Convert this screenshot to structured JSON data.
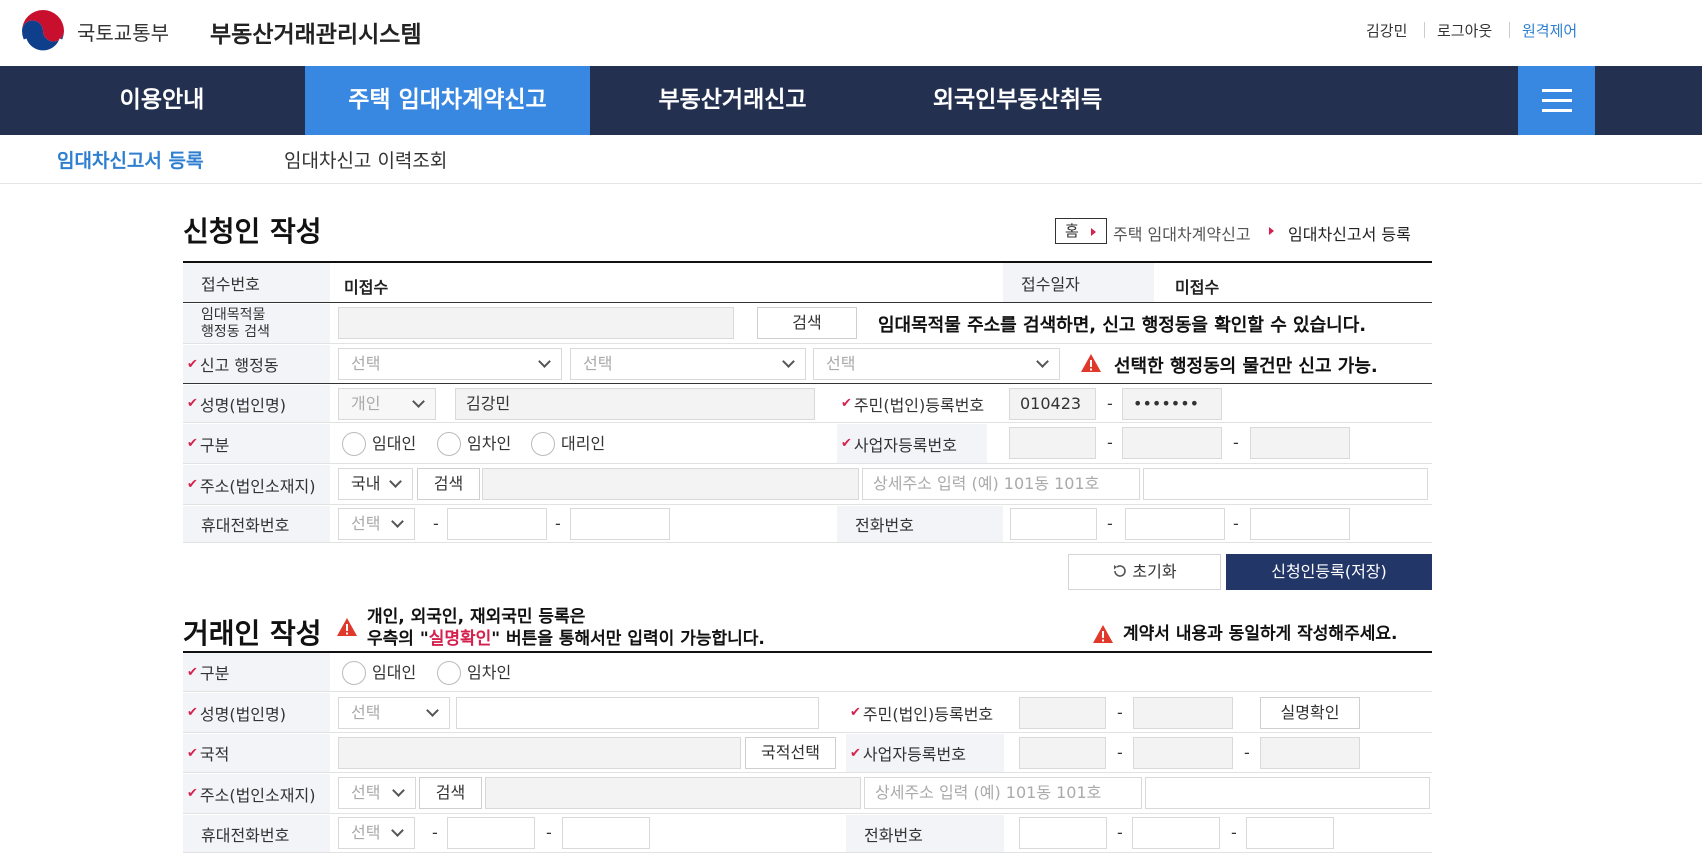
{
  "header": {
    "ministry": "국토교통부",
    "system_name": "부동산거래관리시스템",
    "user_name": "김강민",
    "logout": "로그아웃",
    "remote": "원격제어"
  },
  "gnb": {
    "items": [
      "이용안내",
      "주택 임대차계약신고",
      "부동산거래신고",
      "외국인부동산취득"
    ],
    "active_index": 1
  },
  "subnav": {
    "items": [
      "임대차신고서 등록",
      "임대차신고 이력조회"
    ],
    "active_index": 0
  },
  "breadcrumb": {
    "home": "홈",
    "middle": "주택 임대차계약신고",
    "current": "임대차신고서 등록"
  },
  "applicant": {
    "title": "신청인 작성",
    "receipt_no_label": "접수번호",
    "receipt_no_value": "미접수",
    "receipt_date_label": "접수일자",
    "receipt_date_value": "미접수",
    "admin_search_label_1": "임대목적물",
    "admin_search_label_2": "행정동 검색",
    "search_button": "검색",
    "admin_notice": "임대목적물 주소를 검색하면, 신고 행정동을 확인할 수 있습니다.",
    "report_dong_label": "신고 행정동",
    "select_placeholder": "선택",
    "dong_warning": "선택한 행정동의 물건만 신고 가능.",
    "name_label": "성명(법인명)",
    "person_type": "개인",
    "name_value": "김강민",
    "rrn_label": "주민(법인)등록번호",
    "rrn_front": "010423",
    "rrn_back": "•••••••",
    "division_label": "구분",
    "radio_lessor": "임대인",
    "radio_lessee": "임차인",
    "radio_agent": "대리인",
    "biz_no_label": "사업자등록번호",
    "address_label": "주소(법인소재지)",
    "address_country": "국내",
    "address_detail_placeholder": "상세주소 입력 (예) 101동 101호",
    "mobile_label": "휴대전화번호",
    "phone_label": "전화번호",
    "reset_button": "초기화",
    "save_button": "신청인등록(저장)"
  },
  "trader": {
    "title": "거래인 작성",
    "notice_line1": "개인, 외국인, 재외국민 등록은",
    "notice_line2_pre": "우측의 \"",
    "notice_line2_red": "실명확인",
    "notice_line2_post": "\" 버튼을 통해서만 입력이 가능합니다.",
    "contract_notice": "계약서 내용과 동일하게 작성해주세요.",
    "division_label": "구분",
    "radio_lessor": "임대인",
    "radio_lessee": "임차인",
    "name_label": "성명(법인명)",
    "select_placeholder": "선택",
    "rrn_label": "주민(법인)등록번호",
    "verify_button": "실명확인",
    "nationality_label": "국적",
    "nationality_button": "국적선택",
    "biz_no_label": "사업자등록번호",
    "address_label": "주소(법인소재지)",
    "search_button": "검색",
    "address_detail_placeholder": "상세주소 입력 (예) 101동 101호",
    "mobile_label": "휴대전화번호",
    "phone_label": "전화번호"
  },
  "colors": {
    "navy": "#243050",
    "accent_blue": "#3887e0",
    "save_button": "#233668",
    "required_red": "#d6204e"
  }
}
